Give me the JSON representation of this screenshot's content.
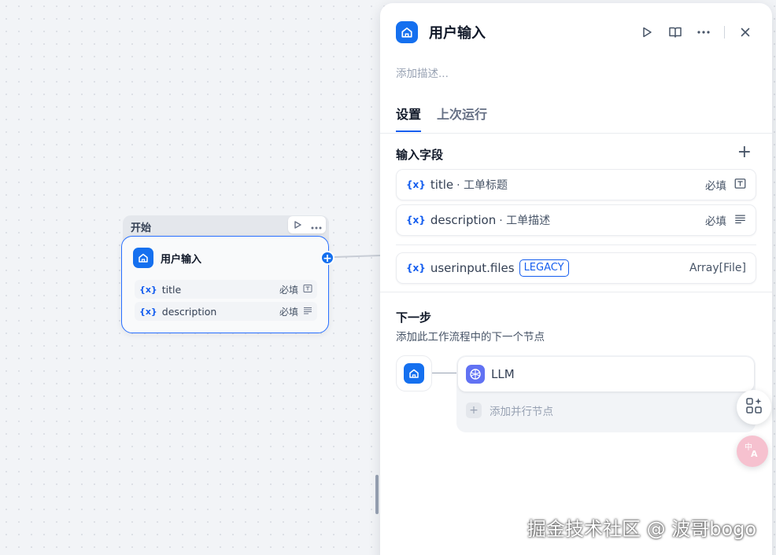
{
  "canvas": {
    "start_label": "开始",
    "node": {
      "title": "用户输入",
      "vars": [
        {
          "name": "title",
          "required": "必填",
          "icon": "text-input-icon"
        },
        {
          "name": "description",
          "required": "必填",
          "icon": "paragraph-icon"
        }
      ],
      "var_prefix": "{x}"
    }
  },
  "panel": {
    "title": "用户输入",
    "description_placeholder": "添加描述...",
    "tabs": [
      {
        "label": "设置",
        "active": true
      },
      {
        "label": "上次运行",
        "active": false
      }
    ],
    "input_fields_title": "输入字段",
    "fields": [
      {
        "prefix": "{x}",
        "name": "title",
        "desc": "· 工单标题",
        "required": "必填",
        "icon": "text-input-icon"
      },
      {
        "prefix": "{x}",
        "name": "description",
        "desc": "· 工单描述",
        "required": "必填",
        "icon": "paragraph-icon"
      }
    ],
    "legacy_field": {
      "prefix": "{x}",
      "name": "userinput.files",
      "badge": "LEGACY",
      "type": "Array[File]"
    },
    "next_step": {
      "title": "下一步",
      "subtitle": "添加此工作流程中的下一个节点",
      "node_name": "LLM",
      "add_parallel": "添加并行节点"
    }
  },
  "watermark": "掘金技术社区 @ 波哥bogo",
  "colors": {
    "accent": "#155eef",
    "node_badge": "#1570ef",
    "llm_badge": "#6172f3"
  }
}
